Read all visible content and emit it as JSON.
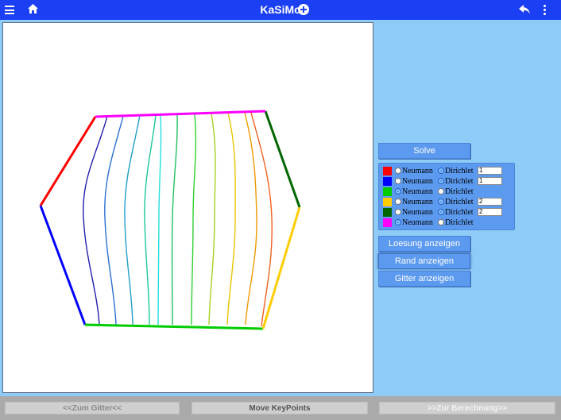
{
  "app": {
    "title": "KaSiMo"
  },
  "icons": {
    "menu": "menu-icon",
    "home": "home-icon",
    "add": "plus-circle-icon",
    "back": "back-arrow-icon",
    "more": "more-vertical-icon"
  },
  "colors": {
    "topbar": "#1b3ff2",
    "background": "#8ecbf7",
    "button": "#5c9af0"
  },
  "actions": {
    "solve": "Solve",
    "show_solution": "Loesung anzeigen",
    "show_boundary": "Rand anzeigen",
    "show_grid": "Gitter anzeigen"
  },
  "boundary_conditions": [
    {
      "color": "#ff0000",
      "neumann_label": "Neumann",
      "dirichlet_label": "Dirichlet",
      "selected": "dirichlet",
      "value": "1"
    },
    {
      "color": "#0000ff",
      "neumann_label": "Neumann",
      "dirichlet_label": "Dirichlet",
      "selected": "dirichlet",
      "value": "1"
    },
    {
      "color": "#00cc00",
      "neumann_label": "Neumann",
      "dirichlet_label": "Dirichlet",
      "selected": "neumann",
      "value": null
    },
    {
      "color": "#ffcc00",
      "neumann_label": "Neumann",
      "dirichlet_label": "Dirichlet",
      "selected": "dirichlet",
      "value": "2"
    },
    {
      "color": "#006600",
      "neumann_label": "Neumann",
      "dirichlet_label": "Dirichlet",
      "selected": "dirichlet",
      "value": "2"
    },
    {
      "color": "#ff00ff",
      "neumann_label": "Neumann",
      "dirichlet_label": "Dirichlet",
      "selected": "neumann",
      "value": null
    }
  ],
  "footer": {
    "prev": "<<Zum Gitter<<",
    "middle": "Move KeyPoints",
    "next": ">>Zur Berechnung>>"
  }
}
